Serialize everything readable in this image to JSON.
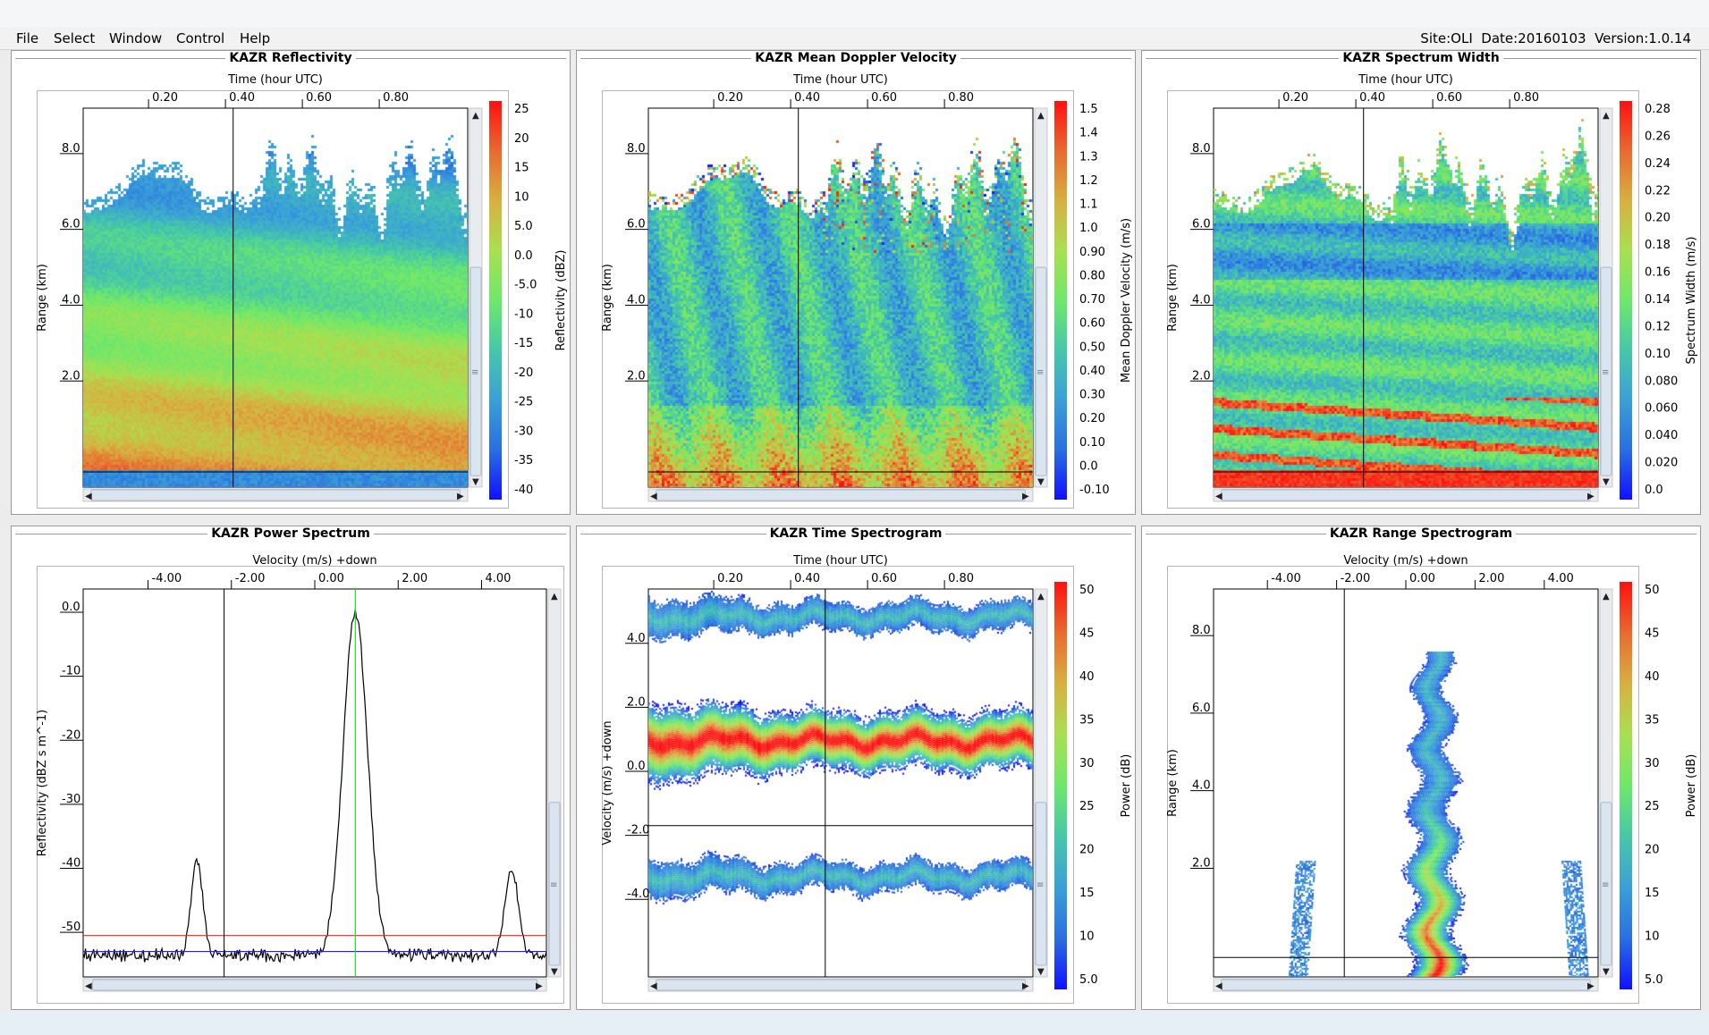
{
  "menu": [
    "File",
    "Select",
    "Window",
    "Control",
    "Help"
  ],
  "site_info": "Site:OLI  Date:20160103  Version:1.0.14",
  "colors": {
    "colormap": [
      "#1010ff",
      "#2a6fe0",
      "#3aa0d8",
      "#46c8a8",
      "#6ee86a",
      "#a8e050",
      "#d8b040",
      "#e86a30",
      "#ff1010"
    ],
    "panel_border": "#9a9a9a",
    "crosshair": "#000000",
    "spectrum_line": "#000000",
    "peak_marker": "#22dd22",
    "noise_upper": "#ff2020",
    "noise_lower": "#2020ff"
  },
  "icons": {
    "scroll_up": "▲",
    "scroll_down": "▼",
    "scroll_left": "◀",
    "scroll_right": "▶",
    "grip": "≡"
  },
  "panels": [
    {
      "id": "reflectivity",
      "title": "KAZR Reflectivity",
      "top_label": "Time (hour UTC)",
      "top_ticks": [
        "0.20",
        "0.40",
        "0.60",
        "0.80"
      ],
      "left_label": "Range (km)",
      "left_ticks": [
        "8.0",
        "6.0",
        "4.0",
        "2.0"
      ],
      "colorbar_label": "Reflectivity (dBZ)",
      "colorbar_ticks": [
        "25",
        "20",
        "15",
        "10",
        "5.0",
        "0.0",
        "-5.0",
        "-10",
        "-15",
        "-20",
        "-25",
        "-30",
        "-35",
        "-40"
      ]
    },
    {
      "id": "velocity",
      "title": "KAZR Mean Doppler Velocity",
      "top_label": "Time (hour UTC)",
      "top_ticks": [
        "0.20",
        "0.40",
        "0.60",
        "0.80"
      ],
      "left_label": "Range (km)",
      "left_ticks": [
        "8.0",
        "6.0",
        "4.0",
        "2.0"
      ],
      "colorbar_label": "Mean Doppler Velocity (m/s)",
      "colorbar_ticks": [
        "1.5",
        "1.4",
        "1.3",
        "1.2",
        "1.1",
        "1.0",
        "0.90",
        "0.80",
        "0.70",
        "0.60",
        "0.50",
        "0.40",
        "0.30",
        "0.20",
        "0.10",
        "0.0",
        "-0.10"
      ]
    },
    {
      "id": "width",
      "title": "KAZR Spectrum Width",
      "top_label": "Time (hour UTC)",
      "top_ticks": [
        "0.20",
        "0.40",
        "0.60",
        "0.80"
      ],
      "left_label": "Range (km)",
      "left_ticks": [
        "8.0",
        "6.0",
        "4.0",
        "2.0"
      ],
      "colorbar_label": "Spectrum Width (m/s)",
      "colorbar_ticks": [
        "0.28",
        "0.26",
        "0.24",
        "0.22",
        "0.20",
        "0.18",
        "0.16",
        "0.14",
        "0.12",
        "0.10",
        "0.080",
        "0.060",
        "0.040",
        "0.020",
        "0.0"
      ]
    },
    {
      "id": "power",
      "title": "KAZR Power Spectrum",
      "top_label": "Velocity (m/s) +down",
      "top_ticks": [
        "-4.00",
        "-2.00",
        "0.00",
        "2.00",
        "4.00"
      ],
      "left_label": "Reflectivity (dBZ s m^-1)",
      "left_ticks": [
        "0.0",
        "-10",
        "-20",
        "-30",
        "-40",
        "-50"
      ]
    },
    {
      "id": "timespec",
      "title": "KAZR Time Spectrogram",
      "top_label": "Time (hour UTC)",
      "top_ticks": [
        "0.20",
        "0.40",
        "0.60",
        "0.80"
      ],
      "left_label": "Velocity (m/s) +down",
      "left_ticks": [
        "4.0",
        "2.0",
        "0.0",
        "-2.0",
        "-4.0"
      ],
      "colorbar_label": "Power (dB)",
      "colorbar_ticks": [
        "50",
        "45",
        "40",
        "35",
        "30",
        "25",
        "20",
        "15",
        "10",
        "5.0"
      ]
    },
    {
      "id": "rangespec",
      "title": "KAZR Range Spectrogram",
      "top_label": "Velocity (m/s) +down",
      "top_ticks": [
        "-4.00",
        "-2.00",
        "0.00",
        "2.00",
        "4.00"
      ],
      "left_label": "Range (km)",
      "left_ticks": [
        "8.0",
        "6.0",
        "4.0",
        "2.0"
      ],
      "colorbar_label": "Power (dB)",
      "colorbar_ticks": [
        "50",
        "45",
        "40",
        "35",
        "30",
        "25",
        "20",
        "15",
        "10",
        "5.0"
      ]
    }
  ]
}
